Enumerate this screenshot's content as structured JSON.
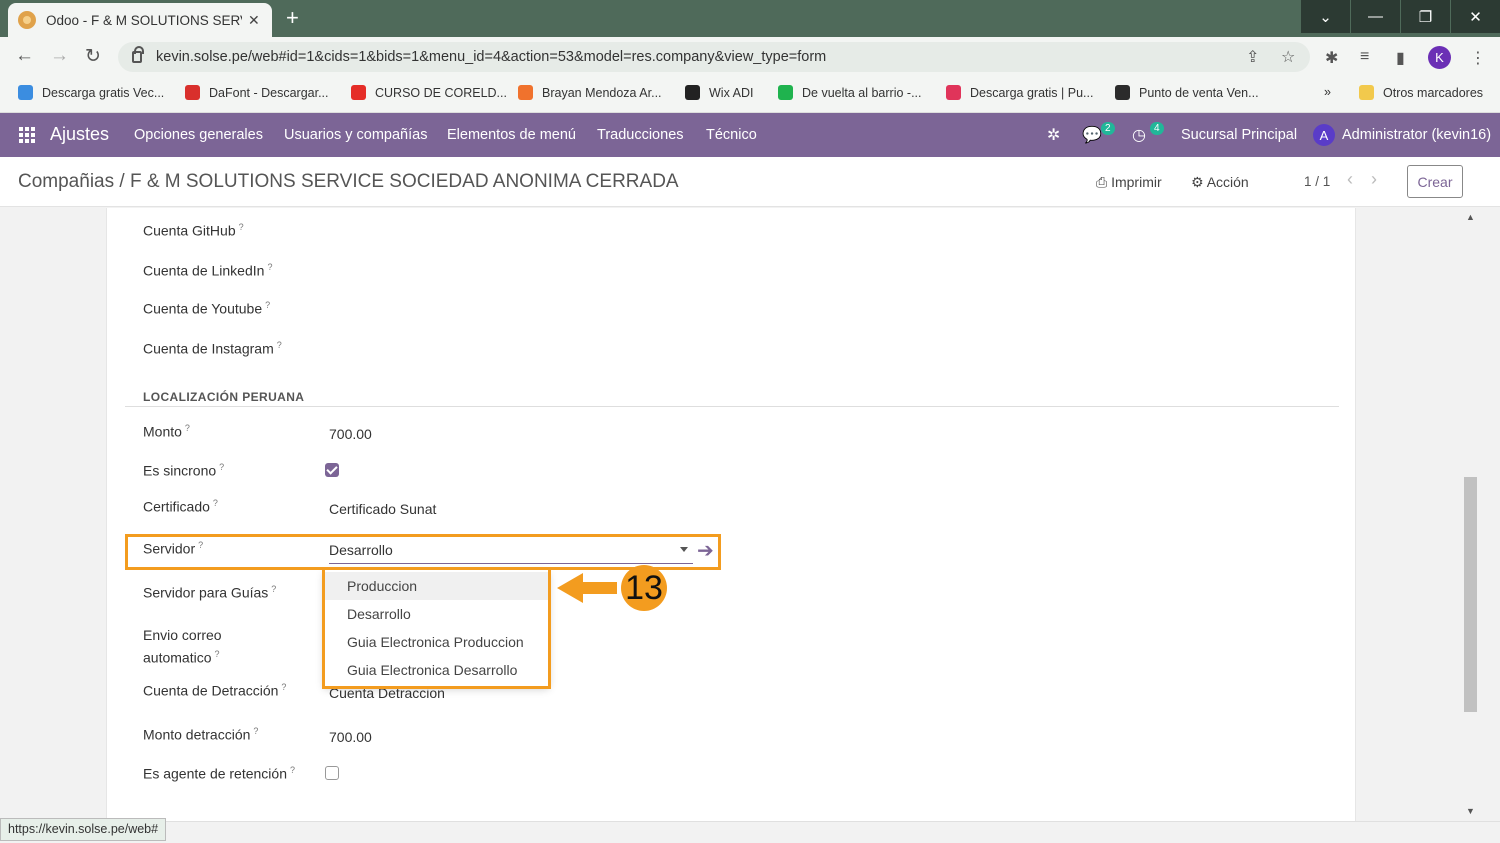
{
  "browser": {
    "tab_title": "Odoo - F & M SOLUTIONS SERVICE",
    "url": "kevin.solse.pe/web#id=1&cids=1&bids=1&menu_id=4&action=53&model=res.company&view_type=form",
    "profile_initial": "K",
    "bookmarks": [
      {
        "label": "Descarga gratis Vec...",
        "color": "#3b8de0"
      },
      {
        "label": "DaFont - Descargar...",
        "color": "#d9302c"
      },
      {
        "label": "CURSO DE CORELD...",
        "color": "#e52d27"
      },
      {
        "label": "Brayan Mendoza Ar...",
        "color": "#f0722d"
      },
      {
        "label": "Wix ADI",
        "color": "#222222"
      },
      {
        "label": "De vuelta al barrio -...",
        "color": "#1fb34e"
      },
      {
        "label": "Descarga gratis | Pu...",
        "color": "#e0345a"
      },
      {
        "label": "Punto de venta Ven...",
        "color": "#2b2b2b"
      }
    ],
    "bookmarks_more": "»",
    "other_bookmarks": "Otros marcadores",
    "status_url": "https://kevin.solse.pe/web#"
  },
  "navbar": {
    "app_name": "Ajustes",
    "menus": [
      "Opciones generales",
      "Usuarios y compañías",
      "Elementos de menú",
      "Traducciones",
      "Técnico"
    ],
    "chat_badge": "2",
    "activity_badge": "4",
    "branch": "Sucursal Principal",
    "user_initial": "A",
    "user_name": "Administrator (kevin16)"
  },
  "control_panel": {
    "breadcrumb": "Compañias / F & M SOLUTIONS SERVICE SOCIEDAD ANONIMA CERRADA",
    "print_label": "Imprimir",
    "action_label": "Acción",
    "pager": "1 / 1",
    "create_label": "Crear"
  },
  "form": {
    "social_fields": [
      "Cuenta GitHub",
      "Cuenta de LinkedIn",
      "Cuenta de Youtube",
      "Cuenta de Instagram"
    ],
    "section_title": "LOCALIZACIÓN PERUANA",
    "monto_label": "Monto",
    "monto_value": "700.00",
    "sincrono_label": "Es sincrono",
    "certificado_label": "Certificado",
    "certificado_value": "Certificado Sunat",
    "servidor_label": "Servidor",
    "servidor_value": "Desarrollo",
    "servidor_guias_label": "Servidor para Guías",
    "envio_label_line1": "Envio correo",
    "envio_label_line2": "automatico",
    "detraccion_label": "Cuenta de Detracción",
    "detraccion_value": "Cuenta Detraccion",
    "monto_detraccion_label": "Monto detracción",
    "monto_detraccion_value": "700.00",
    "retencion_label": "Es agente de retención",
    "help_mark": "?"
  },
  "dropdown": {
    "options": [
      "Produccion",
      "Desarrollo",
      "Guia Electronica Produccion",
      "Guia Electronica Desarrollo"
    ]
  },
  "annotation": {
    "step_number": "13",
    "color": "#f39c1f"
  }
}
